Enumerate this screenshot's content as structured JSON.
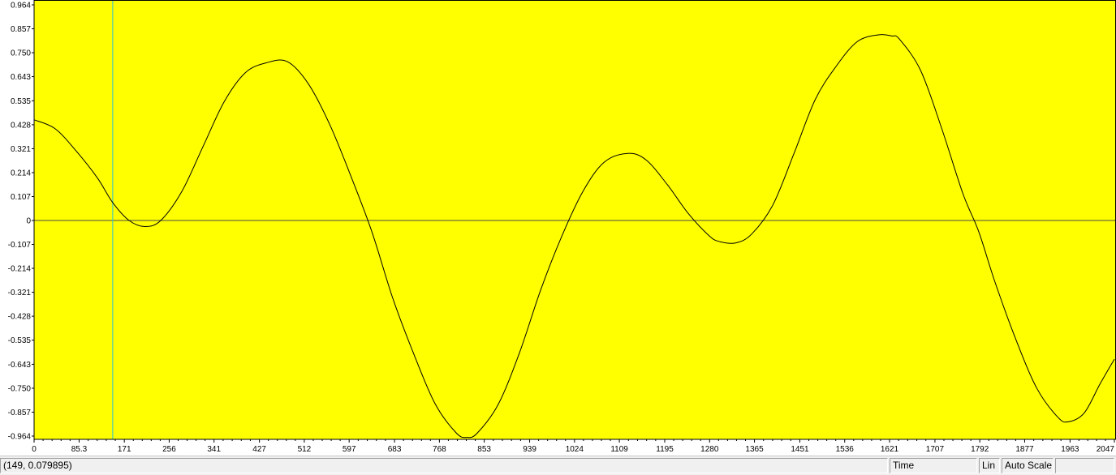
{
  "chart_data": {
    "type": "line",
    "title": "",
    "xlabel": "",
    "ylabel": "",
    "xlim": [
      0,
      2047
    ],
    "ylim": [
      -0.964,
      0.964
    ],
    "x_ticks": [
      "0",
      "85.3",
      "171",
      "256",
      "341",
      "427",
      "512",
      "597",
      "683",
      "768",
      "853",
      "939",
      "1024",
      "1109",
      "1195",
      "1280",
      "1365",
      "1451",
      "1536",
      "1621",
      "1707",
      "1792",
      "1877",
      "1963",
      "2047"
    ],
    "y_ticks": [
      "0.964",
      "0.857",
      "0.750",
      "0.643",
      "0.535",
      "0.428",
      "0.321",
      "0.214",
      "0.107",
      "0",
      "-0.107",
      "-0.214",
      "-0.321",
      "-0.428",
      "-0.535",
      "-0.643",
      "-0.750",
      "-0.857",
      "-0.964"
    ],
    "grid": false,
    "legend": "none",
    "background_color": "#ffff00",
    "line_color": "#000000",
    "zero_line_color": "#4a4a4a",
    "cursor_color": "#29c4d4",
    "cursor_x": 149,
    "series": [
      {
        "x": [
          0,
          40,
          80,
          120,
          149,
          180,
          210,
          240,
          280,
          320,
          360,
          400,
          440,
          480,
          520,
          560,
          600,
          640,
          680,
          720,
          760,
          800,
          820,
          840,
          880,
          920,
          960,
          1000,
          1040,
          1080,
          1125,
          1160,
          1200,
          1240,
          1280,
          1300,
          1330,
          1360,
          1400,
          1440,
          1480,
          1520,
          1560,
          1600,
          1625,
          1640,
          1680,
          1720,
          1760,
          1790,
          1820,
          1860,
          1900,
          1940,
          1960,
          1990,
          2020,
          2047
        ],
        "values": [
          0.45,
          0.41,
          0.31,
          0.19,
          0.08,
          0.0,
          -0.027,
          0.0,
          0.13,
          0.33,
          0.53,
          0.66,
          0.705,
          0.71,
          0.61,
          0.43,
          0.2,
          -0.05,
          -0.35,
          -0.6,
          -0.82,
          -0.95,
          -0.97,
          -0.95,
          -0.82,
          -0.59,
          -0.31,
          -0.07,
          0.13,
          0.26,
          0.3,
          0.27,
          0.16,
          0.03,
          -0.07,
          -0.095,
          -0.1,
          -0.06,
          0.07,
          0.3,
          0.54,
          0.69,
          0.8,
          0.83,
          0.825,
          0.81,
          0.67,
          0.41,
          0.12,
          -0.05,
          -0.27,
          -0.53,
          -0.75,
          -0.88,
          -0.9,
          -0.86,
          -0.73,
          -0.62
        ]
      }
    ]
  },
  "status": {
    "coords": "(149, 0.079895)",
    "domain": "Time",
    "scale": "Lin",
    "autoscale": "Auto Scale",
    "extra": ""
  }
}
